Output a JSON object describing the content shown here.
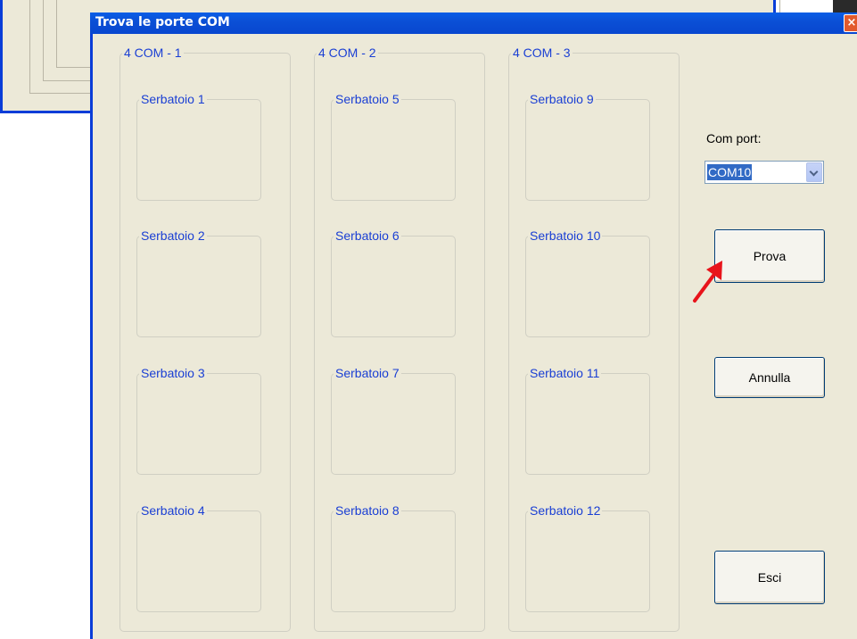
{
  "dialog": {
    "title": "Trova le porte COM",
    "close_glyph": "×"
  },
  "groups": [
    {
      "label": "4 COM - 1",
      "tanks": [
        "Serbatoio 1",
        "Serbatoio 2",
        "Serbatoio 3",
        "Serbatoio 4"
      ]
    },
    {
      "label": "4 COM - 2",
      "tanks": [
        "Serbatoio 5",
        "Serbatoio 6",
        "Serbatoio 7",
        "Serbatoio 8"
      ]
    },
    {
      "label": "4 COM - 3",
      "tanks": [
        "Serbatoio 9",
        "Serbatoio 10",
        "Serbatoio 11",
        "Serbatoio 12"
      ]
    }
  ],
  "com_port": {
    "label": "Com port:",
    "value": "COM10"
  },
  "buttons": {
    "prova": "Prova",
    "annulla": "Annulla",
    "esci": "Esci"
  },
  "colors": {
    "titlebar": "#0b50d6",
    "group_label": "#1a3fd4",
    "annotation_arrow": "#e8141b"
  }
}
